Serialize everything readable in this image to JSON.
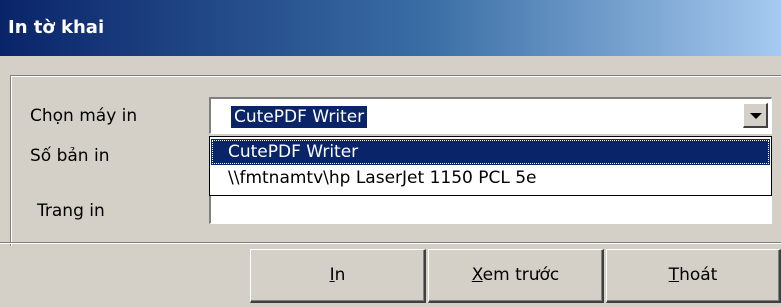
{
  "window": {
    "title": "In tờ khai"
  },
  "form": {
    "printer_label": "Chọn máy in",
    "copies_label": "Số bản in",
    "pages_label": "Trang in",
    "printer_selected": "CutePDF Writer",
    "printer_options": [
      "CutePDF Writer",
      "\\\\fmtnamtv\\hp LaserJet 1150 PCL 5e"
    ],
    "pages_value": ""
  },
  "buttons": {
    "print": {
      "key": "I",
      "rest": "n"
    },
    "preview": {
      "key": "X",
      "rest": "em trước"
    },
    "exit": {
      "key": "T",
      "rest": "hoát"
    }
  },
  "icons": {
    "dropdown": "chevron-down-icon"
  },
  "colors": {
    "title_start": "#0a246a",
    "title_end": "#a6caf0",
    "selection": "#0a246a",
    "face": "#d4d0c8"
  }
}
